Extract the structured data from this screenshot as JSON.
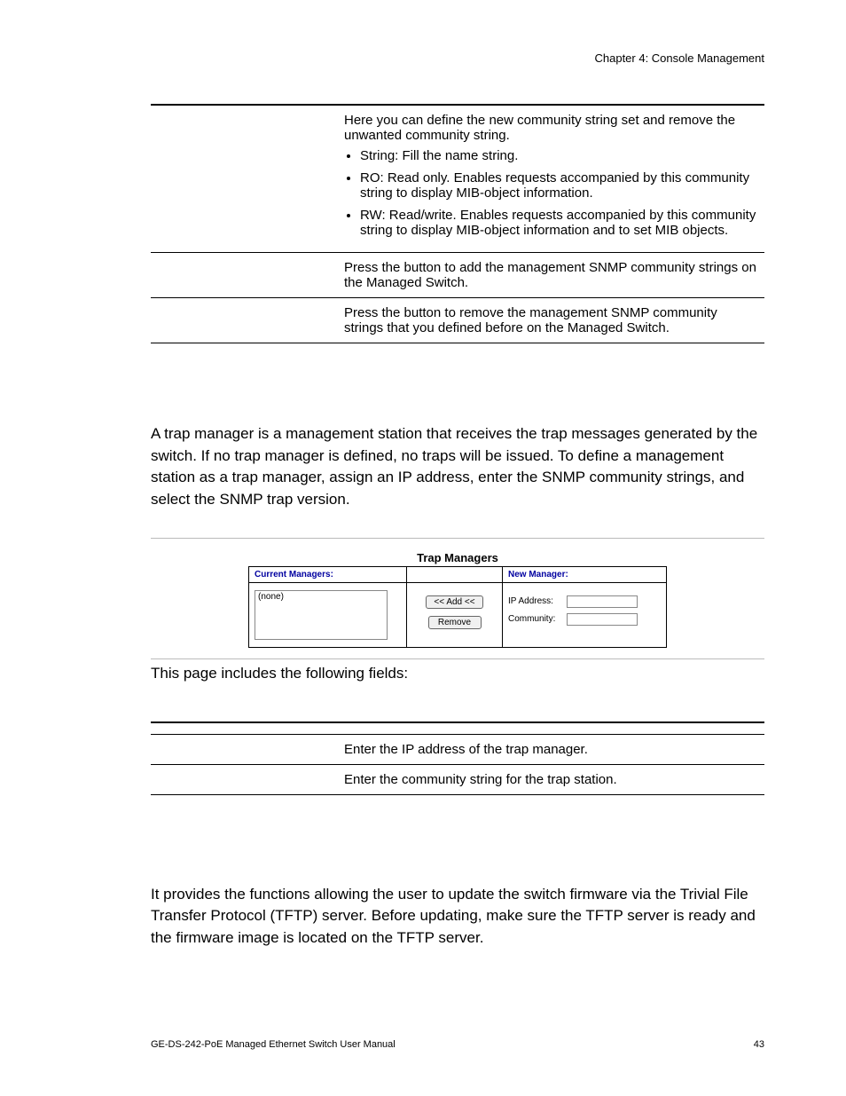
{
  "header": "Chapter 4: Console Management",
  "table1": {
    "row1_intro": "Here you can define the new community string set and remove the unwanted community string.",
    "b1": "String: Fill the name string.",
    "b2": "RO: Read only. Enables requests accompanied by this community string to display MIB-object information.",
    "b3": "RW: Read/write. Enables requests accompanied by this community string to display MIB-object information and to set MIB objects.",
    "row2": "Press the button to add the management SNMP community strings on the Managed Switch.",
    "row3": "Press the button to remove the management SNMP community strings that you defined before on the Managed Switch."
  },
  "trap_intro": "A trap manager is a management station that receives the trap messages generated by the switch. If no trap manager is defined, no traps will be issued. To define a management station as a trap manager, assign an IP address, enter the SNMP community strings, and select the SNMP trap version.",
  "trap_panel": {
    "title": "Trap Managers",
    "col_current": "Current Managers:",
    "col_new": "New Manager:",
    "list_value": "(none)",
    "btn_add": "<< Add <<",
    "btn_remove": "Remove",
    "lbl_ip": "IP Address:",
    "lbl_comm": "Community:"
  },
  "fields_caption": "This page includes the following fields:",
  "table2": {
    "r1": "Enter the IP address of the trap manager.",
    "r2": "Enter the community string for the trap station."
  },
  "tftp_para": "It provides the functions allowing the user to update the switch firmware via the Trivial File Transfer Protocol (TFTP) server. Before updating, make sure the TFTP server is ready and the firmware image is located on the TFTP server.",
  "footer_left": "GE-DS-242-PoE Managed Ethernet Switch User Manual",
  "footer_right": "43"
}
